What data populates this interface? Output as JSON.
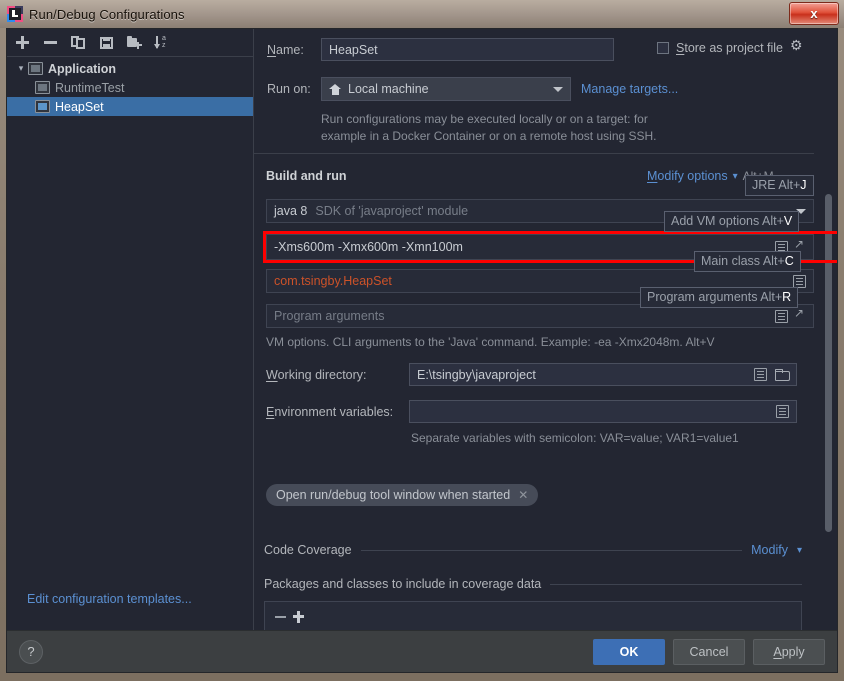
{
  "window": {
    "title": "Run/Debug Configurations",
    "close_label": "x",
    "app_icon": "intellij-idea-icon"
  },
  "sidebar": {
    "toolbar": [
      {
        "name": "add-configuration-button",
        "glyph": "+"
      },
      {
        "name": "remove-configuration-button",
        "glyph": "−"
      },
      {
        "name": "copy-configuration-button",
        "glyph": "copy-icon"
      },
      {
        "name": "save-configuration-button",
        "glyph": "save-icon"
      },
      {
        "name": "move-into-folder-button",
        "glyph": "folder-add-icon"
      },
      {
        "name": "sort-configurations-button",
        "glyph": "sort-az-icon"
      }
    ],
    "tree": [
      {
        "label": "Application",
        "type": "group",
        "expanded": true
      },
      {
        "label": "RuntimeTest",
        "type": "child",
        "selected": false
      },
      {
        "label": "HeapSet",
        "type": "child",
        "selected": true
      }
    ],
    "edit_templates_link": "Edit configuration templates..."
  },
  "form": {
    "name_label": "Name:",
    "name_value": "HeapSet",
    "store_as_project_file_label": "Store as project file",
    "store_as_project_file_checked": false,
    "run_on_label": "Run on:",
    "run_on_value": "Local machine",
    "manage_targets_link": "Manage targets...",
    "run_on_description_line1": "Run configurations may be executed locally or on a target: for",
    "run_on_description_line2": "example in a Docker Container or on a remote host using SSH.",
    "build_and_run_header": "Build and run",
    "modify_options_link": "Modify options",
    "modify_options_shortcut": "Alt+M",
    "jre_value": "java 8",
    "jre_suffix": "SDK of 'javaproject' module",
    "vm_options_value": "-Xms600m -Xmx600m -Xmn100m",
    "main_class_value": "com.tsingby.HeapSet",
    "program_arguments_placeholder": "Program arguments",
    "vm_options_hint": "VM options. CLI arguments to the  'Java'   command. Example: -ea -Xmx2048m. Alt+V",
    "working_directory_label": "Working directory:",
    "working_directory_value": "E:\\tsingby\\javaproject",
    "environment_variables_label": "Environment variables:",
    "environment_variables_value": "",
    "environment_variables_hint": "Separate variables with semicolon: VAR=value; VAR1=value1",
    "open_tool_window_chip": "Open run/debug tool window when started",
    "code_coverage_header": "Code Coverage",
    "code_coverage_modify_link": "Modify",
    "coverage_packages_header": "Packages and classes to include in coverage data"
  },
  "tooltips": [
    {
      "name": "jre-shortcut-tip",
      "text": "JRE Alt+",
      "key": "J"
    },
    {
      "name": "add-vm-options-shortcut-tip",
      "text": "Add VM options Alt+",
      "key": "V"
    },
    {
      "name": "main-class-shortcut-tip",
      "text": "Main class Alt+",
      "key": "C"
    },
    {
      "name": "program-arguments-shortcut-tip",
      "text": "Program arguments Alt+",
      "key": "R"
    }
  ],
  "footer": {
    "help_label": "?",
    "ok_label": "OK",
    "cancel_label": "Cancel",
    "apply_label": "Apply"
  },
  "colors": {
    "accent_blue": "#3d6fb5",
    "link_blue": "#5b90d2",
    "annotation_red": "#ff0000",
    "main_class_orange": "#cc5229",
    "panel_bg": "#232632",
    "selection_blue": "#3a6ea5"
  }
}
